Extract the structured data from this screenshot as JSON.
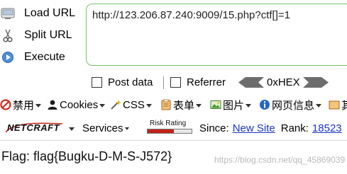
{
  "commands": {
    "load_url": "Load URL",
    "split_url": "Split URL",
    "execute": "Execute"
  },
  "url": {
    "value": "http://123.206.87.240:9009/15.php?ctf[]=1"
  },
  "options": {
    "post_data": "Post data",
    "referrer": "Referrer",
    "hex": "0xHEX"
  },
  "toolbar": {
    "disable": "禁用",
    "cookies": "Cookies",
    "css": "CSS",
    "forms": "表单",
    "images": "图片",
    "page_info": "网页信息",
    "next_cut": "其"
  },
  "netcraft": {
    "logo": "NETCRAFT",
    "services": "Services",
    "risk_rating": "Risk Rating",
    "since_label": "Since:",
    "since_value": "New Site",
    "rank_label": "Rank:",
    "rank_value": "18523"
  },
  "result": {
    "flag_text": "Flag: flag{Bugku-D-M-S-J572}",
    "watermark": "https://blog.csdn.net/qq_45869039"
  },
  "colors": {
    "url_border": "#7bbf6a",
    "link": "#1a35c4",
    "disable_red": "#d42a1c"
  }
}
